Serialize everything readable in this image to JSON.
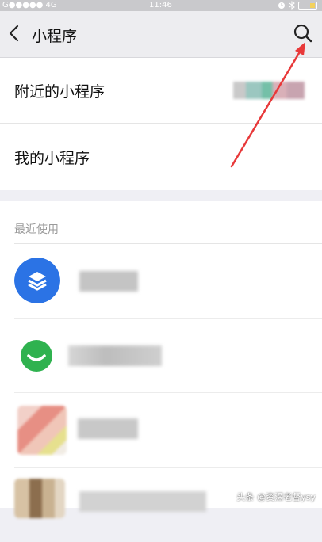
{
  "status_bar": {
    "carrier": "G●●●●● 4G",
    "time": "11:46"
  },
  "nav": {
    "title": "小程序",
    "back_icon": "chevron-left-icon",
    "search_icon": "search-icon"
  },
  "menu": {
    "nearby_label": "附近的小程序",
    "mine_label": "我的小程序"
  },
  "recent": {
    "header": "最近使用",
    "apps": [
      {
        "icon": "stack-layers-icon",
        "color": "#2b73e5"
      },
      {
        "icon": "smiley-chat-icon",
        "color": "#2fb24f"
      },
      {
        "icon": "mosaic-icon",
        "color": "#e9a49a"
      },
      {
        "icon": "mosaic-icon",
        "color": "#a68a6a"
      }
    ]
  },
  "watermark": {
    "prefix": "头条",
    "handle": "@资深老督ysy"
  },
  "colors": {
    "accent_arrow": "#e8393a",
    "nav_bg": "#ededf0",
    "page_bg": "#efeff4"
  }
}
